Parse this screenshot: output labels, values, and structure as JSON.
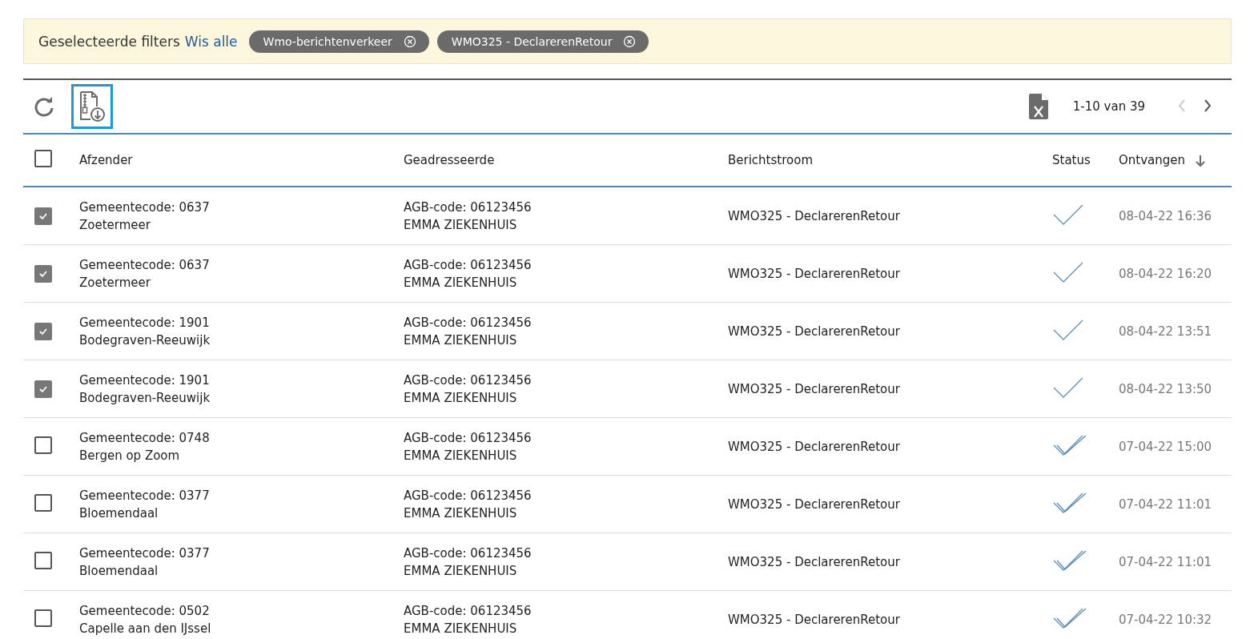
{
  "filters": {
    "label": "Geselecteerde filters",
    "clear_link": "Wis alle",
    "chips": [
      {
        "label": "Wmo-berichtenverkeer"
      },
      {
        "label": "WMO325 - DeclarerenRetour"
      }
    ]
  },
  "toolbar": {
    "pagination": {
      "range": "1-10 van 39",
      "prev_disabled": true,
      "next_disabled": false
    }
  },
  "table": {
    "all_checked": false,
    "columns": [
      "Afzender",
      "Geadresseerde",
      "Berichtstroom",
      "Status",
      "Ontvangen"
    ],
    "rows": [
      {
        "checked": true,
        "sender": "Gemeentecode: 0637",
        "sender_name": "Zoetermeer",
        "recipient": "AGB-code: 06123456",
        "recipient_name": "EMMA ZIEKENHUIS",
        "stream": "WMO325 - DeclarerenRetour",
        "kind": "single",
        "received": "08-04-22 16:36"
      },
      {
        "checked": true,
        "sender": "Gemeentecode: 0637",
        "sender_name": "Zoetermeer",
        "recipient": "AGB-code: 06123456",
        "recipient_name": "EMMA ZIEKENHUIS",
        "stream": "WMO325 - DeclarerenRetour",
        "kind": "single",
        "received": "08-04-22 16:20"
      },
      {
        "checked": true,
        "sender": "Gemeentecode: 1901",
        "sender_name": "Bodegraven-Reeuwijk",
        "recipient": "AGB-code: 06123456",
        "recipient_name": "EMMA ZIEKENHUIS",
        "stream": "WMO325 - DeclarerenRetour",
        "kind": "single",
        "received": "08-04-22 13:51"
      },
      {
        "checked": true,
        "sender": "Gemeentecode: 1901",
        "sender_name": "Bodegraven-Reeuwijk",
        "recipient": "AGB-code: 06123456",
        "recipient_name": "EMMA ZIEKENHUIS",
        "stream": "WMO325 - DeclarerenRetour",
        "kind": "single",
        "received": "08-04-22 13:50"
      },
      {
        "checked": false,
        "sender": "Gemeentecode: 0748",
        "sender_name": "Bergen op Zoom",
        "recipient": "AGB-code: 06123456",
        "recipient_name": "EMMA ZIEKENHUIS",
        "stream": "WMO325 - DeclarerenRetour",
        "kind": "double",
        "received": "07-04-22 15:00"
      },
      {
        "checked": false,
        "sender": "Gemeentecode: 0377",
        "sender_name": "Bloemendaal",
        "recipient": "AGB-code: 06123456",
        "recipient_name": "EMMA ZIEKENHUIS",
        "stream": "WMO325 - DeclarerenRetour",
        "kind": "double",
        "received": "07-04-22 11:01"
      },
      {
        "checked": false,
        "sender": "Gemeentecode: 0377",
        "sender_name": "Bloemendaal",
        "recipient": "AGB-code: 06123456",
        "recipient_name": "EMMA ZIEKENHUIS",
        "stream": "WMO325 - DeclarerenRetour",
        "kind": "double",
        "received": "07-04-22 11:01"
      },
      {
        "checked": false,
        "sender": "Gemeentecode: 0502",
        "sender_name": "Capelle aan den IJssel",
        "recipient": "AGB-code: 06123456",
        "recipient_name": "EMMA ZIEKENHUIS",
        "stream": "WMO325 - DeclarerenRetour",
        "kind": "double",
        "received": "07-04-22 10:32"
      }
    ]
  }
}
